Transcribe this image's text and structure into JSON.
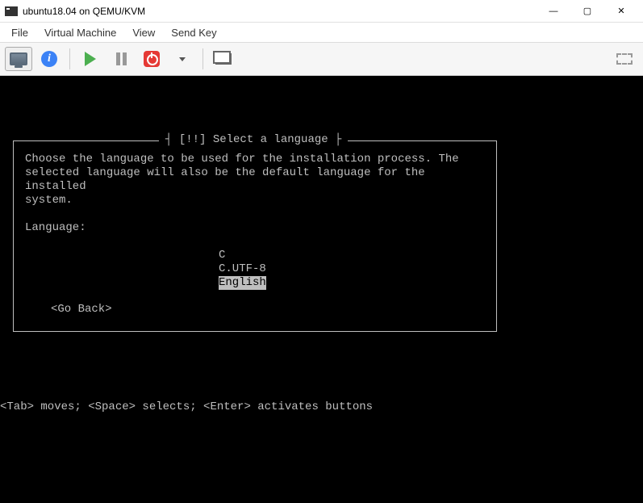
{
  "window": {
    "title": "ubuntu18.04 on QEMU/KVM"
  },
  "menu": {
    "file": "File",
    "virtual_machine": "Virtual Machine",
    "view": "View",
    "send_key": "Send Key"
  },
  "toolbar": {
    "info_glyph": "i"
  },
  "tui": {
    "box_title": "[!!] Select a language",
    "instructions": "Choose the language to be used for the installation process. The\nselected language will also be the default language for the installed\nsystem.",
    "prompt": "Language:",
    "options": {
      "c": "C",
      "cutf8": "C.UTF-8",
      "english": "English"
    },
    "go_back": "<Go Back>",
    "help": "<Tab> moves; <Space> selects; <Enter> activates buttons"
  }
}
